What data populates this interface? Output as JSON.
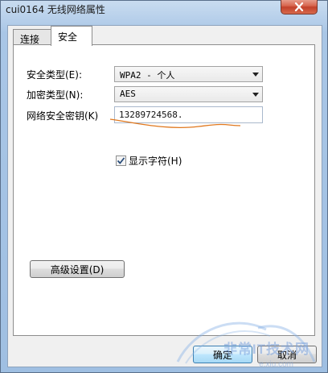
{
  "window": {
    "title": "cui0164 无线网络属性",
    "close_glyph": "close-icon"
  },
  "tabs": [
    {
      "label": "连接",
      "active": false
    },
    {
      "label": "安全",
      "active": true
    }
  ],
  "security": {
    "type_label": "安全类型(E):",
    "type_value": "WPA2 - 个人",
    "encryption_label": "加密类型(N):",
    "encryption_value": "AES",
    "key_label": "网络安全密钥(K)",
    "key_value": "13289724568.",
    "show_chars_label": "显示字符(H)",
    "show_chars_checked": true
  },
  "buttons": {
    "advanced": "高级设置(D)",
    "ok": "确定",
    "cancel": "取消"
  },
  "watermark": {
    "text": "非常IT技术网",
    "sub": "e.xiu.com"
  },
  "colors": {
    "annotation_stroke": "#e0781e",
    "watermark": "#78a0dc"
  }
}
